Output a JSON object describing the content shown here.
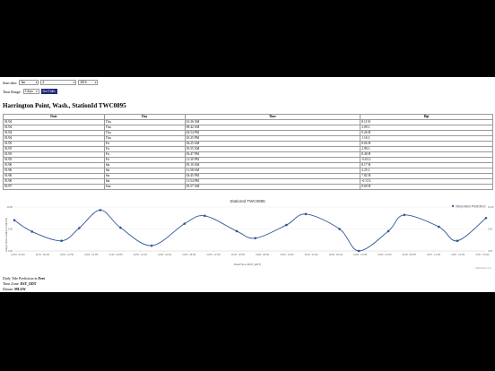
{
  "controls": {
    "start_label": "Start date:",
    "month": "Jan",
    "day": "4",
    "year": "2016",
    "range_label": "Time Range:",
    "range": "3 days",
    "button": "Get Tides"
  },
  "station_title": "Harrington Point, Wash., StationId TWC0895",
  "table": {
    "headers": [
      "Date",
      "Day",
      "Time",
      "Hgt"
    ],
    "rows": [
      [
        "01/04",
        "Thu",
        "01:36 AM",
        "8.11 H"
      ],
      [
        "01/04",
        "Thu",
        "09:42 AM",
        "2.09 L"
      ],
      [
        "01/04",
        "Thu",
        "02:54 PM",
        "9.26 H"
      ],
      [
        "01/04",
        "Thu",
        "10:25 PM",
        "1.16 L"
      ],
      [
        "01/05",
        "Fri",
        "04:25 AM",
        "8.04 H"
      ],
      [
        "01/05",
        "Fri",
        "10:55 AM",
        "2.90 L"
      ],
      [
        "01/05",
        "Fri",
        "03:47 PM",
        "8.40 H"
      ],
      [
        "01/05",
        "Fri",
        "11:39 PM",
        "-0.03 L"
      ],
      [
        "01/06",
        "Sat",
        "05:10 AM",
        "8.17 H"
      ],
      [
        "01/06",
        "Sat",
        "11:58 AM",
        "2.25 L"
      ],
      [
        "01/06",
        "Sat",
        "04:45 PM",
        "7.82 H"
      ],
      [
        "01/06",
        "Sat",
        "11:54 PM",
        "-0.13 L"
      ],
      [
        "01/07",
        "Sun",
        "05:57 AM",
        "8.69 H"
      ]
    ]
  },
  "chart_data": {
    "type": "line",
    "title": "StationId TWC0895",
    "xlabel": "Date/Time (EST_EDT)",
    "ylabel": "Height (Feet relative to MLLW)",
    "ylim": [
      0,
      10
    ],
    "yticks": [
      "10.00",
      "5.00",
      "0.00"
    ],
    "right_yticks": [
      "10.00",
      "5.00",
      "0.00"
    ],
    "xticks": [
      "01/04 - 04 AM",
      "01/04 - 08 AM",
      "01/04 - 12 PM",
      "01/04 - 04 PM",
      "01/04 - 08 PM",
      "01/05 - 12 AM",
      "01/05 - 04 AM",
      "01/05 - 08 AM",
      "01/05 - 12 PM",
      "01/05 - 04 PM",
      "01/05 - 08 PM",
      "01/06 - 12 AM",
      "01/06 - 04 AM",
      "01/06 - 08 AM",
      "01/06 - 12 PM",
      "01/06 - 04 PM",
      "01/06 - 08 PM",
      "01/07 - 12 AM",
      "01/07 - 04 AM",
      "01/07 - 08 AM"
    ],
    "series": [
      {
        "name": "Interpolated Predictions",
        "color": "#2f5597",
        "x": [
          0,
          2.1,
          5.6,
          7.7,
          10.2,
          12.6,
          16.3,
          20.2,
          22.6,
          26.4,
          28.6,
          32.3,
          34.6,
          38.6,
          40.9,
          44.4,
          46.3,
          50.4,
          52.6,
          56.0
        ],
        "values": [
          7.0,
          4.4,
          2.3,
          5.2,
          9.3,
          5.3,
          1.2,
          6.2,
          8.0,
          4.5,
          2.9,
          5.9,
          8.4,
          5.0,
          0.0,
          4.5,
          8.2,
          5.5,
          2.3,
          7.5
        ]
      }
    ],
    "legend": "top-right"
  },
  "info": {
    "units_label": "Daily Tide Prediction in",
    "units_value": "Feet",
    "tz_label": "Time Zone:",
    "tz_value": "EST_EDT",
    "datum_label": "Datum:",
    "datum_value": "MLLW"
  },
  "credit": "Highcharts.com"
}
